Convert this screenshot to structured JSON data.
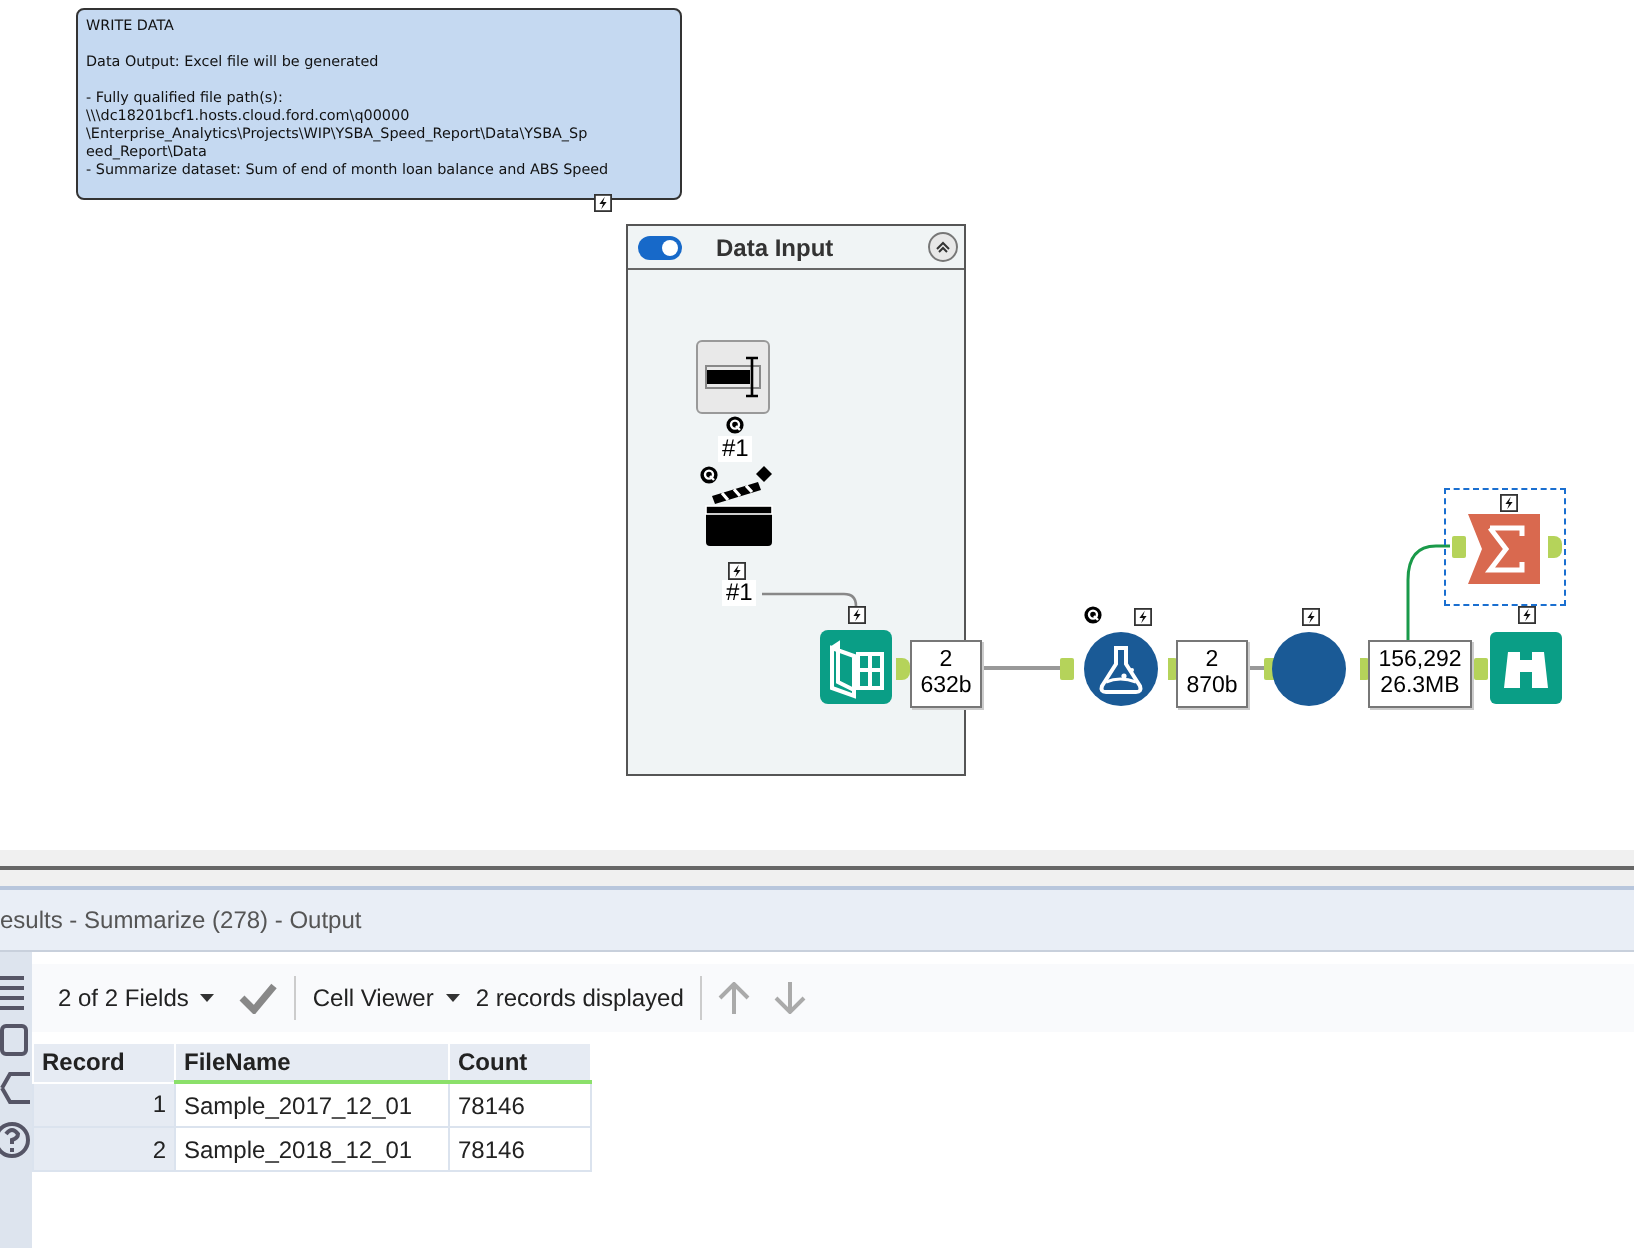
{
  "comment": {
    "paragraphs": [
      [
        "WRITE DATA"
      ],
      [
        "Data Output: Excel file will be generated"
      ],
      [
        "- Fully qualified file path(s):",
        "\\\\\\dc18201bcf1.hosts.cloud.ford.com\\q00000",
        "\\Enterprise_Analytics\\Projects\\WIP\\YSBA_Speed_Report\\Data\\YSBA_Sp",
        "eed_Report\\Data",
        "- Summarize dataset: Sum of end of month loan balance and ABS Speed"
      ]
    ]
  },
  "container": {
    "title": "Data Input",
    "enabled": true
  },
  "nodes": [
    {
      "kind": "text-input",
      "label": "#1",
      "selected": false
    },
    {
      "kind": "clapper",
      "label": "#1",
      "selected": false
    },
    {
      "kind": "input",
      "selected": false
    },
    {
      "kind": "formula",
      "selected": false
    },
    {
      "kind": "circle",
      "selected": false
    },
    {
      "kind": "summarize",
      "selected": true
    },
    {
      "kind": "browse",
      "selected": false
    }
  ],
  "record_counts": [
    {
      "records": "2",
      "size": "632b"
    },
    {
      "records": "2",
      "size": "870b"
    },
    {
      "records": "156,292",
      "size": "26.3MB"
    }
  ],
  "results": {
    "title": "esults - Summarize (278) - Output",
    "fields": "2 of 2 Fields",
    "viewer": "Cell Viewer",
    "records": "2 records displayed"
  },
  "table": {
    "columns": [
      "Record",
      "FileName",
      "Count"
    ],
    "rows": [
      [
        "1",
        "Sample_2017_12_01",
        "78146"
      ],
      [
        "2",
        "Sample_2018_12_01",
        "78146"
      ]
    ]
  }
}
